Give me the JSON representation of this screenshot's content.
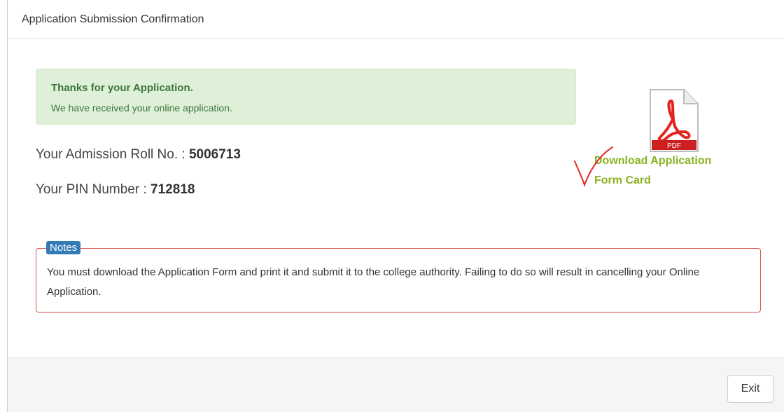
{
  "modal": {
    "title": "Application Submission Confirmation"
  },
  "alert": {
    "title": "Thanks for your Application.",
    "text": "We have received your online application."
  },
  "info": {
    "roll_label": "Your Admission Roll No. : ",
    "roll_value": "5006713",
    "pin_label": "Your PIN Number : ",
    "pin_value": "712818"
  },
  "download": {
    "icon": "pdf-icon",
    "badge": "PDF",
    "line1": "Download Application",
    "line2": "Form Card"
  },
  "notes": {
    "label": "Notes",
    "text": "You must download the Application Form and print it and submit it to the college authority. Failing to do so will result in cancelling your Online Application."
  },
  "footer": {
    "exit_label": "Exit"
  },
  "colors": {
    "success_bg": "#dff0d8",
    "success_text": "#3c763d",
    "link_green": "#8ab220",
    "notes_border": "#d9534f",
    "notes_badge": "#337ab7",
    "pdf_red": "#e52421"
  }
}
